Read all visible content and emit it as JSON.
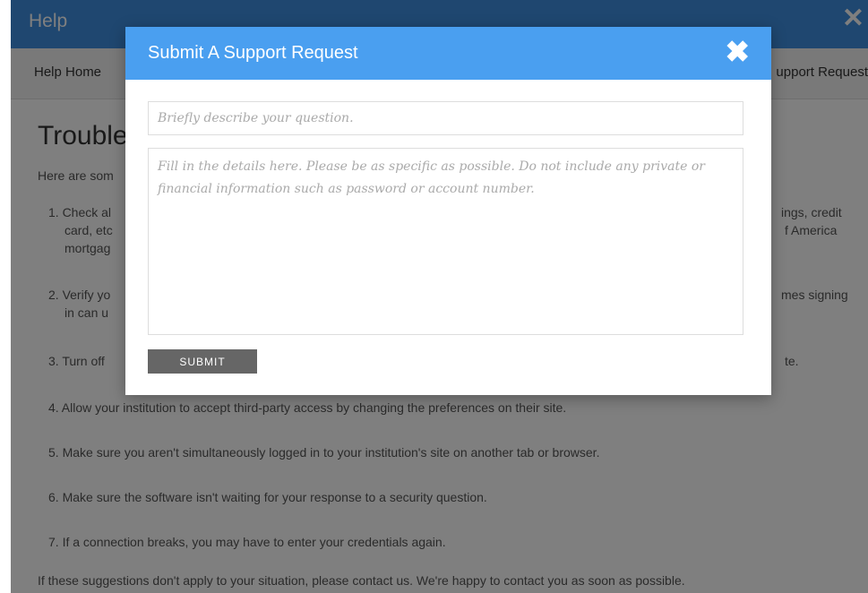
{
  "help": {
    "title": "Help",
    "nav": {
      "home": "Help Home",
      "support": "upport Request"
    },
    "heading": "Trouble",
    "intro": "Here are som",
    "steps": [
      {
        "left": "1. Check al",
        "left2": "card, etc",
        "left3": "mortgag",
        "right": "ings, credit",
        "right2": "f America"
      },
      {
        "left": "2. Verify yo",
        "left2": "in can u",
        "right": "mes signing"
      },
      {
        "left": "3. Turn off",
        "right": "te."
      },
      {
        "text": "4. Allow your institution to accept third-party access by changing the preferences on their site."
      },
      {
        "text": "5. Make sure you aren't simultaneously logged in to your institution's site on another tab or browser."
      },
      {
        "text": "6. Make sure the software isn't waiting for your response to a security question."
      },
      {
        "text": "7. If a connection breaks, you may have to enter your credentials again."
      }
    ],
    "footer": "If these suggestions don't apply to your situation, please contact us. We're happy to contact you as soon as possible."
  },
  "modal": {
    "title": "Submit A Support Request",
    "close_icon": "close-icon",
    "subject_placeholder": "Briefly describe your question.",
    "subject_value": "",
    "details_placeholder": "Fill in the details here. Please be as specific as possible. Do not include any private or financial information such as password or account number.",
    "details_value": "",
    "submit_label": "SUBMIT"
  },
  "colors": {
    "header_blue": "#3f8fe0",
    "modal_header_blue": "#4a9ff0",
    "submit_gray": "#666666"
  }
}
